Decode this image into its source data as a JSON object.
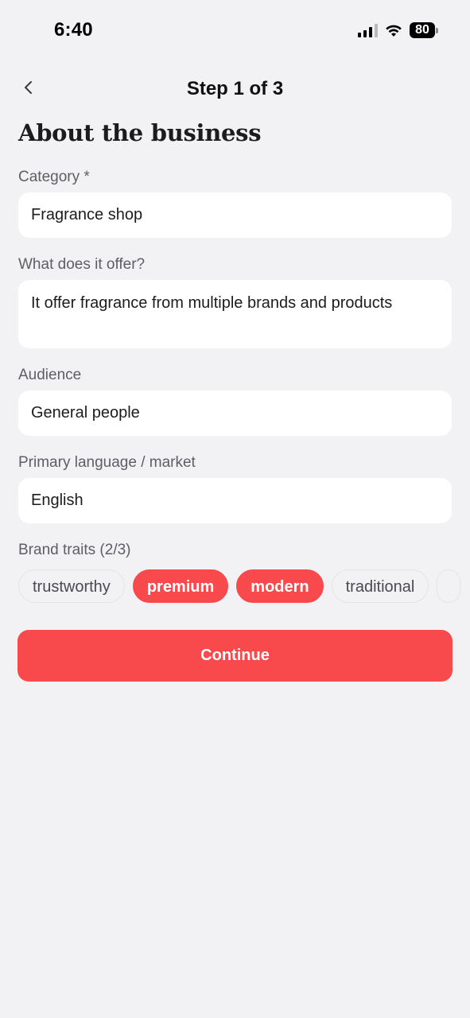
{
  "status_bar": {
    "time": "6:40",
    "battery": "80",
    "icons": [
      "signal-icon",
      "wifi-icon",
      "battery-icon"
    ]
  },
  "header": {
    "back_icon": "chevron-left-icon",
    "title": "Step 1 of 3"
  },
  "page": {
    "title": "About the business"
  },
  "form": {
    "category": {
      "label": "Category *",
      "value": "Fragrance shop"
    },
    "offer": {
      "label": "What does it offer?",
      "value": "It offer fragrance from multiple brands and products"
    },
    "audience": {
      "label": "Audience",
      "value": "General people"
    },
    "language": {
      "label": "Primary language / market",
      "value": "English"
    },
    "traits": {
      "label": "Brand traits (2/3)",
      "items": [
        {
          "label": "trustworthy",
          "selected": false
        },
        {
          "label": "premium",
          "selected": true
        },
        {
          "label": "modern",
          "selected": true
        },
        {
          "label": "traditional",
          "selected": false
        }
      ]
    }
  },
  "actions": {
    "continue_label": "Continue"
  },
  "colors": {
    "accent": "#f8494c",
    "background": "#f2f2f5",
    "field_background": "#ffffff",
    "label_text": "#5e5e63"
  }
}
